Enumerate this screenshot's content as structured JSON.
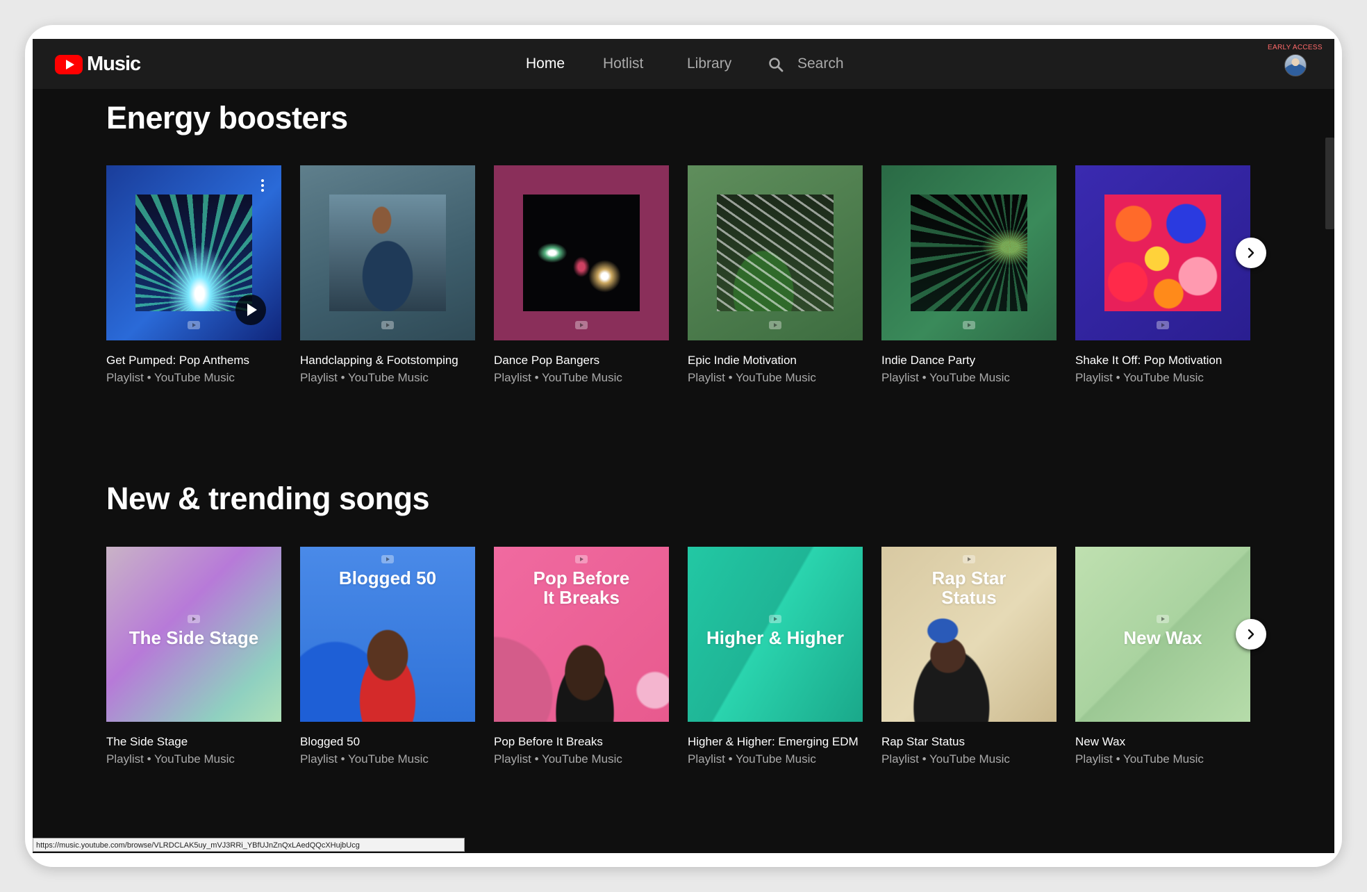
{
  "header": {
    "logo_text": "Music",
    "nav": [
      {
        "label": "Home",
        "active": true
      },
      {
        "label": "Hotlist",
        "active": false
      },
      {
        "label": "Library",
        "active": false
      }
    ],
    "search_label": "Search",
    "early_access": "EARLY ACCESS",
    "avatar_icon": "user-avatar"
  },
  "sections": [
    {
      "title": "Energy boosters",
      "cards": [
        {
          "title": "Get Pumped: Pop Anthems",
          "subtitle": "Playlist • YouTube Music"
        },
        {
          "title": "Handclapping & Footstomping",
          "subtitle": "Playlist • YouTube Music"
        },
        {
          "title": "Dance Pop Bangers",
          "subtitle": "Playlist • YouTube Music"
        },
        {
          "title": "Epic Indie Motivation",
          "subtitle": "Playlist • YouTube Music"
        },
        {
          "title": "Indie Dance Party",
          "subtitle": "Playlist • YouTube Music"
        },
        {
          "title": "Shake It Off: Pop Motivation",
          "subtitle": "Playlist • YouTube Music"
        }
      ]
    },
    {
      "title": "New & trending songs",
      "cards": [
        {
          "title": "The Side Stage",
          "subtitle": "Playlist • YouTube Music",
          "art_text": "The Side Stage"
        },
        {
          "title": "Blogged 50",
          "subtitle": "Playlist • YouTube Music",
          "art_text": "Blogged 50"
        },
        {
          "title": "Pop Before It Breaks",
          "subtitle": "Playlist • YouTube Music",
          "art_text_1": "Pop Before",
          "art_text_2": "It Breaks"
        },
        {
          "title": "Higher & Higher: Emerging EDM",
          "subtitle": "Playlist • YouTube Music",
          "art_text": "Higher & Higher"
        },
        {
          "title": "Rap Star Status",
          "subtitle": "Playlist • YouTube Music",
          "art_text_1": "Rap Star",
          "art_text_2": "Status"
        },
        {
          "title": "New Wax",
          "subtitle": "Playlist • YouTube Music",
          "art_text": "New Wax"
        }
      ]
    }
  ],
  "status_url": "https://music.youtube.com/browse/VLRDCLAK5uy_mVJ3RRi_YBfUJnZnQxLAedQQcXHujbUcg",
  "colors": {
    "background": "#0f0f0f",
    "header": "#1c1c1c",
    "brand_red": "#ff0000",
    "secondary_text": "#aaaaaa"
  }
}
